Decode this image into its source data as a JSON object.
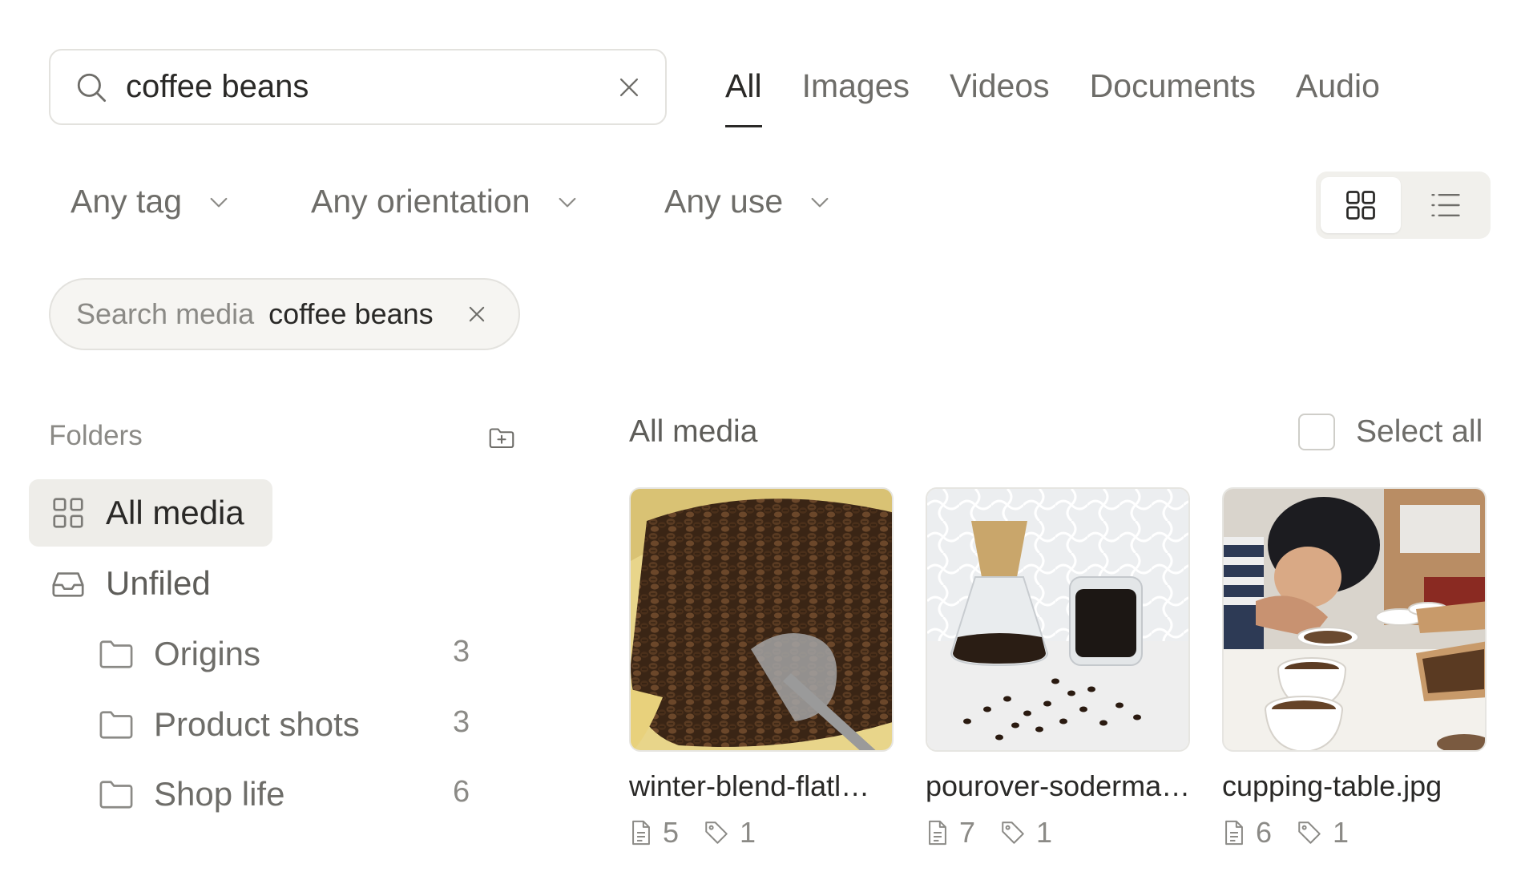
{
  "search": {
    "value": "coffee beans"
  },
  "tabs": [
    {
      "label": "All",
      "active": true
    },
    {
      "label": "Images"
    },
    {
      "label": "Videos"
    },
    {
      "label": "Documents"
    },
    {
      "label": "Audio"
    }
  ],
  "filters": {
    "tag": "Any tag",
    "orientation": "Any orientation",
    "use": "Any use"
  },
  "view_mode": "grid",
  "query_chip": {
    "label": "Search media",
    "value": "coffee beans"
  },
  "sidebar": {
    "folders_label": "Folders",
    "all_media": "All media",
    "unfiled": "Unfiled",
    "folders": [
      {
        "name": "Origins",
        "count": "3"
      },
      {
        "name": "Product shots",
        "count": "3"
      },
      {
        "name": "Shop life",
        "count": "6"
      }
    ]
  },
  "main": {
    "title": "All media",
    "select_all": "Select all",
    "items": [
      {
        "name": "winter-blend-flatl…",
        "pages": "5",
        "tags": "1",
        "image": "coffee-beans-in-burlap-sack-with-scoop"
      },
      {
        "name": "pourover-soderma…",
        "pages": "7",
        "tags": "1",
        "image": "pour-over-coffee-maker-with-cup-and-beans"
      },
      {
        "name": "cupping-table.jpg",
        "pages": "6",
        "tags": "1",
        "image": "person-cupping-coffee-at-table"
      }
    ]
  }
}
